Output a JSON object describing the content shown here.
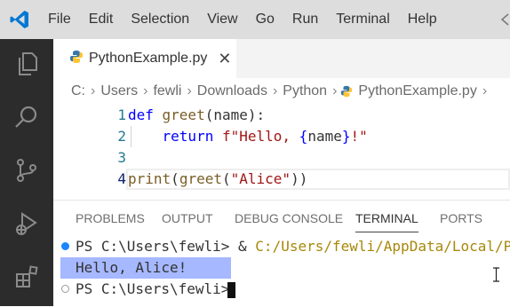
{
  "menu": [
    "File",
    "Edit",
    "Selection",
    "View",
    "Go",
    "Run",
    "Terminal",
    "Help"
  ],
  "tab": {
    "label": "PythonExample.py",
    "close": "✕"
  },
  "breadcrumb": [
    "C:",
    "Users",
    "fewli",
    "Downloads",
    "Python",
    "PythonExample.py"
  ],
  "breadcrumb_sep": "›",
  "code_lines": [
    {
      "num": "1",
      "parts": [
        [
          "kw",
          "def "
        ],
        [
          "fn",
          "greet"
        ],
        [
          "",
          "(name):"
        ]
      ]
    },
    {
      "num": "2",
      "parts": [
        [
          "",
          "    "
        ],
        [
          "kw",
          "return "
        ],
        [
          "str",
          "f\"Hello, "
        ],
        [
          "kw",
          "{"
        ],
        [
          "",
          "name"
        ],
        [
          "kw",
          "}"
        ],
        [
          "str",
          "!\""
        ]
      ]
    },
    {
      "num": "3",
      "parts": []
    },
    {
      "num": "4",
      "parts": [
        [
          "fn",
          "print"
        ],
        [
          "",
          "("
        ],
        [
          "fn",
          "greet"
        ],
        [
          "",
          "("
        ],
        [
          "str",
          "\"Alice\""
        ],
        [
          "",
          "))"
        ]
      ]
    }
  ],
  "panel_tabs": [
    "PROBLEMS",
    "OUTPUT",
    "DEBUG CONSOLE",
    "TERMINAL",
    "PORTS"
  ],
  "active_panel_tab": "TERMINAL",
  "terminal": {
    "line1_prompt": "PS C:\\Users\\fewli> & ",
    "line1_cmd": "C:/Users/fewli/AppData/Local/Progr",
    "line2_output": "Hello, Alice!",
    "line3_prompt": "PS C:\\Users\\fewli>"
  },
  "colors": {
    "activity_bar": "#2c2c2c",
    "title_bar": "#dddddd",
    "selection": "#a6b8ff",
    "keyword": "#0000ff",
    "function": "#795e26",
    "string": "#a31515"
  }
}
